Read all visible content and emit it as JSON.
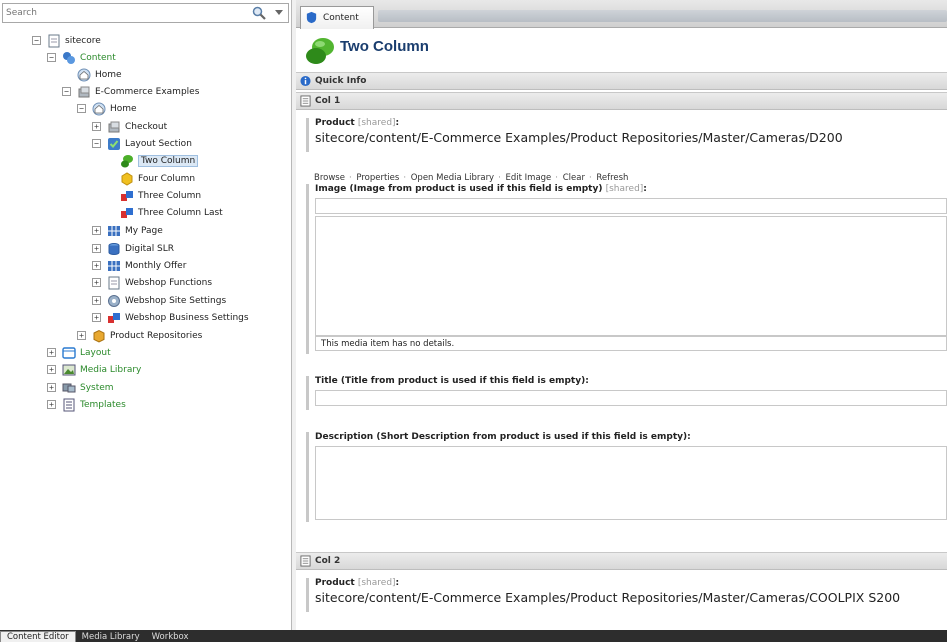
{
  "search": {
    "placeholder": "Search"
  },
  "tree": {
    "sitecore": "sitecore",
    "content": "Content",
    "home_root": "Home",
    "ecommerce_examples": "E-Commerce Examples",
    "home": "Home",
    "checkout": "Checkout",
    "layout_section": "Layout Section",
    "two_column": "Two Column",
    "four_column": "Four Column",
    "three_column": "Three Column",
    "three_column_last": "Three Column Last",
    "my_page": "My Page",
    "digital_slr": "Digital SLR",
    "monthly_offer": "Monthly Offer",
    "webshop_functions": "Webshop Functions",
    "webshop_site_settings": "Webshop Site Settings",
    "webshop_business_settings": "Webshop Business Settings",
    "product_repositories": "Product Repositories",
    "layout": "Layout",
    "media_library": "Media Library",
    "system": "System",
    "templates": "Templates"
  },
  "tabs": {
    "content": "Content"
  },
  "item": {
    "title": "Two Column"
  },
  "sections": {
    "quick_info": "Quick Info",
    "col1": "Col 1",
    "col2": "Col 2"
  },
  "fields": {
    "product_label": "Product",
    "shared": "[shared]",
    "colon": ":",
    "col1_product_value": "sitecore/content/E-Commerce Examples/Product Repositories/Master/Cameras/D200",
    "image_label": "Image (Image from product is used if this field is empty)",
    "image_details": "This media item has no details.",
    "title_label": "Title (Title from product is used if this field is empty):",
    "description_label": "Description (Short Description from product is used if this field is empty):",
    "col2_product_value": "sitecore/content/E-Commerce Examples/Product Repositories/Master/Cameras/COOLPIX S200"
  },
  "image_toolbar": {
    "browse": "Browse",
    "properties": "Properties",
    "open_media_library": "Open Media Library",
    "edit_image": "Edit Image",
    "clear": "Clear",
    "refresh": "Refresh",
    "separator": "·"
  },
  "bottom_tabs": {
    "content_editor": "Content Editor",
    "media_library": "Media Library",
    "workbox": "Workbox"
  },
  "toggles": {
    "minus": "−",
    "plus": "+"
  }
}
